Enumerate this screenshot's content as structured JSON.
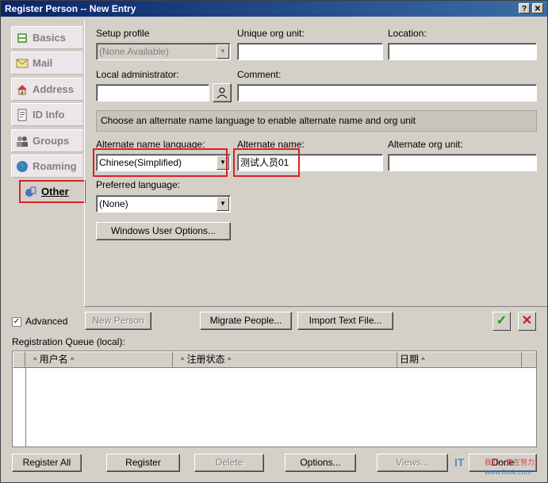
{
  "window": {
    "title": "Register Person -- New Entry",
    "help_btn": "?",
    "close_btn": "✕"
  },
  "sidebar": {
    "items": [
      {
        "label": "Basics",
        "icon": "basics-icon"
      },
      {
        "label": "Mail",
        "icon": "mail-icon"
      },
      {
        "label": "Address",
        "icon": "address-icon"
      },
      {
        "label": "ID Info",
        "icon": "id-info-icon"
      },
      {
        "label": "Groups",
        "icon": "groups-icon"
      },
      {
        "label": "Roaming",
        "icon": "roaming-icon"
      },
      {
        "label": "Other",
        "icon": "other-icon"
      }
    ]
  },
  "form": {
    "setup_profile_label": "Setup profile",
    "setup_profile_value": "(None Available)",
    "unique_org_unit_label": "Unique org unit:",
    "unique_org_unit_value": "",
    "location_label": "Location:",
    "location_value": "",
    "local_admin_label": "Local administrator:",
    "local_admin_value": "",
    "comment_label": "Comment:",
    "comment_value": "",
    "info_text": "Choose an alternate name language to enable alternate name and org unit",
    "alt_lang_label": "Alternate name language:",
    "alt_lang_value": "Chinese(Simplified)",
    "alt_name_label": "Alternate name:",
    "alt_name_value": "测试人员01",
    "alt_org_label": "Alternate org unit:",
    "alt_org_value": "",
    "pref_lang_label": "Preferred language:",
    "pref_lang_value": "(None)",
    "windows_user_options": "Windows User Options..."
  },
  "actions": {
    "advanced_label": "Advanced",
    "advanced_checked": "✓",
    "new_person": "New Person",
    "migrate_people": "Migrate People...",
    "import_text": "Import Text File..."
  },
  "queue": {
    "label": "Registration Queue (local):",
    "columns": [
      "用户名",
      "注册状态",
      "日期"
    ]
  },
  "bottom": {
    "register_all": "Register All",
    "register": "Register",
    "delete": "Delete",
    "options": "Options...",
    "views": "Views...",
    "done": "Done"
  },
  "watermark": {
    "brand": "IT",
    "text1": "我们一直在努力！",
    "text2": "www.itxxk.com"
  }
}
